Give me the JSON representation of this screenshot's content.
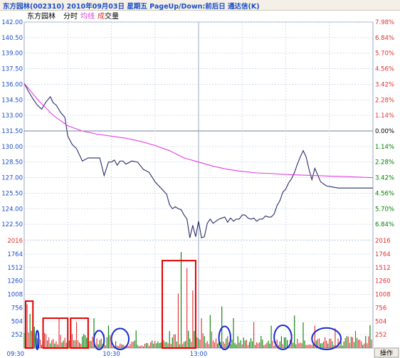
{
  "window": {
    "title": "东方园林(002310) 2010年09月03日 星期五 PageUp/Down:前后日 通达信(K)"
  },
  "legend": {
    "name": "东方园林",
    "fenshi": "分时",
    "junxian": "均线",
    "chengjiao_prefix": "成",
    "chengjiao_suffix": "交量"
  },
  "button": {
    "caozuo": "操作"
  },
  "colors": {
    "price_line": "#2b2b6b",
    "avg_line": "#e040e0",
    "grid": "#c8d4e8",
    "up": "#e03030",
    "down": "#008000",
    "axis_left_text": "#1a4cc8",
    "axis_right_up": "#e03030",
    "axis_right_down": "#008000",
    "highlight_box": "#e00000",
    "highlight_ellipse": "#1a2ad0"
  },
  "chart_data": {
    "type": "line",
    "title": "东方园林(002310) 分时",
    "prev_close": 131.5,
    "price_axis": {
      "ticks": [
        142.0,
        139.37,
        136.75,
        134.12,
        131.5,
        128.87,
        126.24,
        123.62,
        120.99
      ],
      "labels": [
        "142.00",
        "140.50",
        "139.00",
        "137.50",
        "136.00",
        "134.50",
        "133.00",
        "131.50",
        "130.00",
        "128.50",
        "127.00",
        "125.50",
        "124.00",
        "122.50",
        "2016"
      ],
      "ylim": [
        121.1,
        142.0
      ]
    },
    "price_labels_left": [
      "142.00",
      "140.50",
      "139.00",
      "137.50",
      "136.00",
      "134.50",
      "133.00",
      "131.50",
      "130.00",
      "128.50",
      "127.00",
      "125.50",
      "124.00",
      "122.50"
    ],
    "percent_labels_right": [
      "7.98%",
      "6.84%",
      "5.70%",
      "4.56%",
      "3.42%",
      "2.28%",
      "1.14%",
      "0.00%",
      "1.14%",
      "2.28%",
      "3.42%",
      "4.56%",
      "5.70%",
      "6.84%"
    ],
    "volume_axis": {
      "labels": [
        "2016",
        "1764",
        "1512",
        "1260",
        "1008",
        "756",
        "504",
        "252"
      ],
      "ylim": [
        0,
        2016
      ]
    },
    "x_ticks": [
      "09:30",
      "10:30",
      "13:00"
    ],
    "series": [
      {
        "name": "分时",
        "x": [
          0,
          3,
          6,
          9,
          12,
          15,
          18,
          20,
          22,
          25,
          28,
          30,
          33,
          36,
          40,
          44,
          48,
          52,
          55,
          58,
          60,
          62,
          64,
          66,
          68,
          70,
          74,
          78,
          82,
          86,
          90,
          94,
          98,
          100,
          102,
          104,
          106,
          108,
          110,
          112,
          114,
          116,
          118,
          120,
          122,
          124,
          126,
          128,
          130,
          134,
          138,
          140,
          142,
          144,
          146,
          148,
          150,
          152,
          154,
          156,
          158,
          160,
          162,
          164,
          166,
          168,
          170,
          172,
          174,
          176,
          178,
          180,
          182,
          184,
          186,
          188,
          190,
          192,
          194,
          196,
          198,
          200,
          204,
          208,
          212,
          216,
          220,
          224,
          228,
          232,
          236,
          240
        ],
        "y": [
          136.1,
          135.3,
          134.6,
          134.0,
          133.6,
          134.3,
          134.8,
          134.2,
          134.0,
          133.3,
          132.8,
          131.0,
          130.2,
          129.8,
          128.6,
          128.9,
          128.9,
          128.9,
          127.2,
          128.5,
          128.5,
          128.7,
          128.2,
          128.6,
          128.6,
          128.3,
          128.6,
          128.5,
          127.8,
          127.5,
          126.6,
          126.0,
          125.4,
          124.4,
          124.0,
          124.2,
          124.0,
          123.9,
          123.4,
          123.0,
          121.2,
          122.4,
          121.3,
          122.8,
          121.2,
          121.3,
          122.6,
          123.0,
          122.6,
          123.0,
          123.2,
          122.7,
          123.1,
          122.8,
          123.0,
          123.0,
          123.4,
          123.4,
          123.1,
          123.0,
          123.1,
          122.8,
          123.0,
          123.0,
          123.3,
          123.2,
          123.2,
          123.5,
          124.3,
          124.8,
          125.6,
          125.9,
          126.5,
          126.9,
          127.5,
          128.3,
          129.0,
          129.6,
          129.0,
          127.8,
          126.8,
          127.9,
          126.6,
          126.2,
          126.1,
          126.0,
          126.0,
          126.0,
          126.0,
          126.0,
          126.0,
          126.0
        ]
      },
      {
        "name": "均线",
        "x": [
          0,
          10,
          20,
          30,
          40,
          50,
          60,
          70,
          80,
          90,
          100,
          110,
          120,
          130,
          140,
          150,
          160,
          170,
          180,
          190,
          200,
          210,
          220,
          230,
          240
        ],
        "y": [
          136.1,
          134.4,
          133.0,
          132.0,
          131.5,
          131.2,
          131.0,
          130.8,
          130.5,
          130.1,
          129.6,
          128.9,
          128.5,
          128.1,
          127.8,
          127.6,
          127.45,
          127.4,
          127.3,
          127.25,
          127.2,
          127.15,
          127.1,
          127.05,
          127.0
        ]
      }
    ],
    "volume": {
      "name": "成交量",
      "note": "per-minute volume bars; red = up, green = down",
      "peak": 1800,
      "spikes": [
        {
          "t": 2,
          "v": 820
        },
        {
          "t": 4,
          "v": 640
        },
        {
          "t": 6,
          "v": 560
        },
        {
          "t": 14,
          "v": 280
        },
        {
          "t": 24,
          "v": 560
        },
        {
          "t": 32,
          "v": 520
        },
        {
          "t": 36,
          "v": 490
        },
        {
          "t": 48,
          "v": 560
        },
        {
          "t": 58,
          "v": 420
        },
        {
          "t": 77,
          "v": 330
        },
        {
          "t": 106,
          "v": 1020
        },
        {
          "t": 108,
          "v": 1800
        },
        {
          "t": 112,
          "v": 1500
        },
        {
          "t": 116,
          "v": 1080
        },
        {
          "t": 122,
          "v": 560
        },
        {
          "t": 128,
          "v": 620
        },
        {
          "t": 136,
          "v": 780
        },
        {
          "t": 144,
          "v": 560
        },
        {
          "t": 158,
          "v": 490
        },
        {
          "t": 170,
          "v": 420
        },
        {
          "t": 186,
          "v": 610
        },
        {
          "t": 192,
          "v": 480
        },
        {
          "t": 200,
          "v": 420
        },
        {
          "t": 214,
          "v": 370
        },
        {
          "t": 228,
          "v": 320
        },
        {
          "t": 238,
          "v": 430
        }
      ]
    },
    "annotations": [
      {
        "shape": "rect",
        "range": [
          1,
          6
        ],
        "vmax": 880
      },
      {
        "shape": "ellipse",
        "range": [
          8,
          10
        ],
        "vmax": 300
      },
      {
        "shape": "rect",
        "range": [
          13,
          30
        ],
        "vmax": 560
      },
      {
        "shape": "rect",
        "range": [
          32,
          44
        ],
        "vmax": 560
      },
      {
        "shape": "ellipse",
        "range": [
          48,
          55
        ],
        "vmax": 300
      },
      {
        "shape": "ellipse",
        "range": [
          60,
          72
        ],
        "vmax": 340
      },
      {
        "shape": "rect",
        "range": [
          95,
          118
        ],
        "vmax": 1640
      },
      {
        "shape": "ellipse",
        "range": [
          134,
          142
        ],
        "vmax": 380
      },
      {
        "shape": "ellipse",
        "range": [
          172,
          184
        ],
        "vmax": 400
      },
      {
        "shape": "ellipse",
        "range": [
          198,
          218
        ],
        "vmax": 350
      }
    ],
    "grid": true,
    "legend_placement": "top-left"
  }
}
